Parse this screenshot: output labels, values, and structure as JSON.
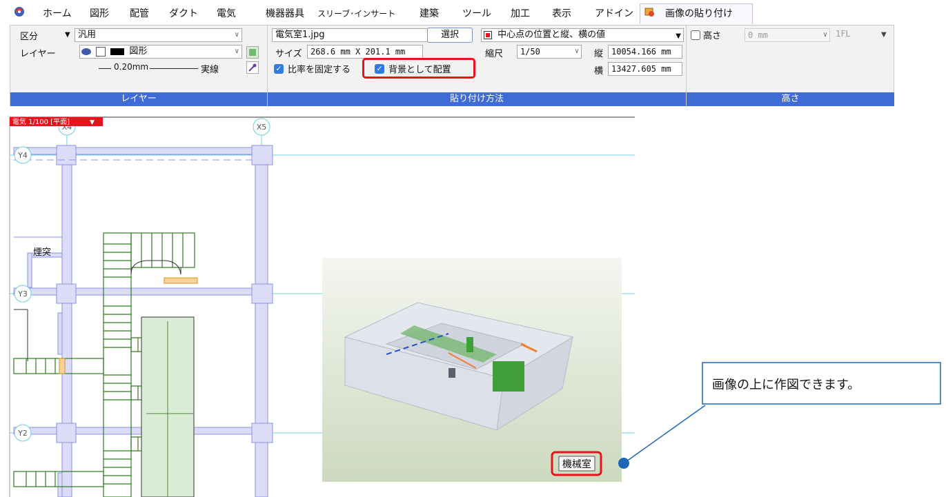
{
  "menu": {
    "items": [
      "ホーム",
      "図形",
      "配管",
      "ダクト",
      "電気",
      "機器器具",
      "スリーブ･インサート",
      "建築",
      "ツール",
      "加工",
      "表示",
      "アドイン"
    ],
    "active": "画像の貼り付け"
  },
  "layer_group": {
    "kubun_label": "区分",
    "kubun_value": "汎用",
    "layer_label": "レイヤー",
    "layer_value": "図形",
    "line_width": "0.20mm",
    "line_type": "実線",
    "footer": "レイヤー"
  },
  "paste_group": {
    "file_name": "電気室1.jpg",
    "select_button": "選択",
    "size_label": "サイズ",
    "size_value": "268.6 mm X 201.1 mm",
    "keep_ratio_label": "比率を固定する",
    "keep_ratio_checked": true,
    "background_label": "背景として配置",
    "background_checked": true,
    "method_value": "中心点の位置と縦、横の値",
    "scale_label": "縮尺",
    "scale_value": "1/50",
    "height_label": "縦",
    "height_value": "10054.166 mm",
    "width_label": "横",
    "width_value": "13427.605 mm",
    "footer": "貼り付け方法"
  },
  "height_group": {
    "check_label": "高さ",
    "checked": false,
    "value": "0 mm",
    "floor": "1FL",
    "footer": "高さ"
  },
  "drawing": {
    "view_tab": "電気 1/100 [平面]",
    "grid_x": [
      "X4",
      "X5"
    ],
    "grid_y": [
      "Y4",
      "Y3",
      "Y2"
    ],
    "room_label": "煙突",
    "mech_room": "機械室",
    "callout": "画像の上に作図できます。"
  },
  "colors": {
    "accent_blue": "#3f6bd6",
    "highlight_red": "#e8121a",
    "wall_blue": "#8e8ee8",
    "tray_green": "#2c7a1e",
    "callout_blue": "#1f66b8"
  }
}
